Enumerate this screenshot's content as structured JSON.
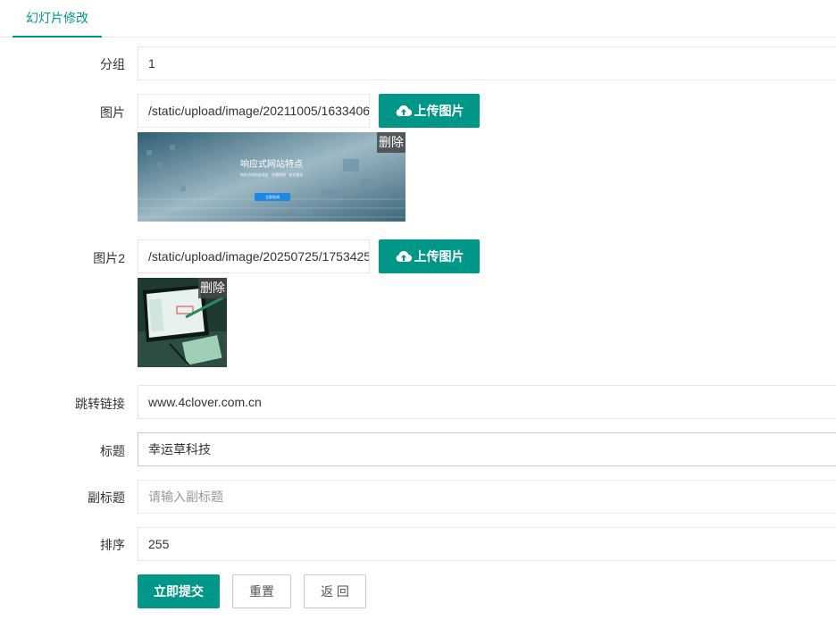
{
  "tab": {
    "label": "幻灯片修改"
  },
  "group": {
    "label": "分组",
    "value": "1"
  },
  "image1": {
    "label": "图片",
    "value": "/static/upload/image/20211005/1633406",
    "upload_label": "上传图片",
    "delete_label": "删除",
    "preview_title": "响应式网站特点",
    "preview_items": [
      "响应式网站自适应",
      "方便浏览",
      "安全稳定"
    ],
    "preview_button": "立即咨询"
  },
  "image2": {
    "label": "图片2",
    "value": "/static/upload/image/20250725/1753425",
    "upload_label": "上传图片",
    "delete_label": "删除"
  },
  "link": {
    "label": "跳转链接",
    "value": "www.4clover.com.cn"
  },
  "title": {
    "label": "标题",
    "value": "幸运草科技"
  },
  "subtitle": {
    "label": "副标题",
    "placeholder": "请输入副标题"
  },
  "sort": {
    "label": "排序",
    "value": "255"
  },
  "actions": {
    "submit": "立即提交",
    "reset": "重置",
    "back": "返 回"
  },
  "colors": {
    "accent": "#009688",
    "border": "#e6e6e6",
    "text": "#333333",
    "placeholder": "#999999"
  }
}
